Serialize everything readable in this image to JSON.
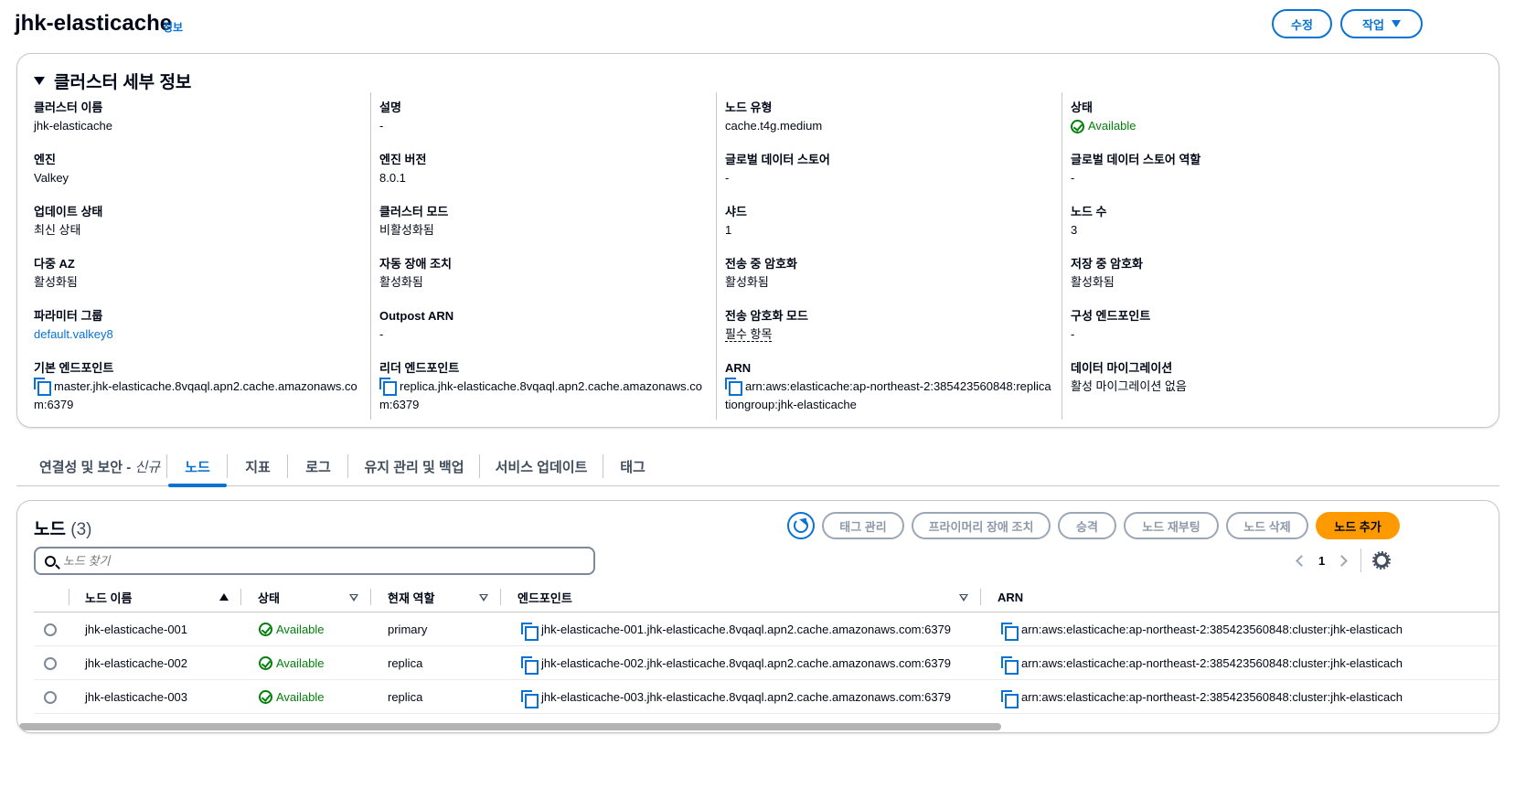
{
  "header": {
    "title": "jhk-elasticache",
    "info_label": "정보",
    "edit_label": "수정",
    "actions_label": "작업"
  },
  "details": {
    "title": "클러스터 세부 정보",
    "columns": [
      [
        {
          "label": "클러스터 이름",
          "value": "jhk-elasticache"
        },
        {
          "label": "엔진",
          "value": "Valkey"
        },
        {
          "label": "업데이트 상태",
          "value": "최신 상태"
        },
        {
          "label": "다중 AZ",
          "value": "활성화됨"
        },
        {
          "label": "파라미터 그룹",
          "value": "default.valkey8"
        },
        {
          "label": "기본 엔드포인트",
          "value": "master.jhk-elasticache.8vqaql.apn2.cache.amazonaws.com:6379"
        }
      ],
      [
        {
          "label": "설명",
          "value": "-"
        },
        {
          "label": "엔진 버전",
          "value": "8.0.1"
        },
        {
          "label": "클러스터 모드",
          "value": "비활성화됨"
        },
        {
          "label": "자동 장애 조치",
          "value": "활성화됨"
        },
        {
          "label": "Outpost ARN",
          "value": "-"
        },
        {
          "label": "리더 엔드포인트",
          "value": "replica.jhk-elasticache.8vqaql.apn2.cache.amazonaws.com:6379"
        }
      ],
      [
        {
          "label": "노드 유형",
          "value": "cache.t4g.medium"
        },
        {
          "label": "글로벌 데이터 스토어",
          "value": "-"
        },
        {
          "label": "샤드",
          "value": "1"
        },
        {
          "label": "전송 중 암호화",
          "value": "활성화됨"
        },
        {
          "label": "전송 암호화 모드",
          "value": "필수 항목"
        },
        {
          "label": "ARN",
          "value": "arn:aws:elasticache:ap-northeast-2:385423560848:replicationgroup:jhk-elasticache"
        }
      ],
      [
        {
          "label": "상태",
          "value": "Available"
        },
        {
          "label": "글로벌 데이터 스토어 역할",
          "value": "-"
        },
        {
          "label": "노드 수",
          "value": "3"
        },
        {
          "label": "저장 중 암호화",
          "value": "활성화됨"
        },
        {
          "label": "구성 엔드포인트",
          "value": "-"
        },
        {
          "label": "데이터 마이그레이션",
          "value": "활성 마이그레이션 없음"
        }
      ]
    ]
  },
  "tabs": [
    {
      "label": "연결성 및 보안 - ",
      "badge": "신규"
    },
    {
      "label": "노드"
    },
    {
      "label": "지표"
    },
    {
      "label": "로그"
    },
    {
      "label": "유지 관리 및 백업"
    },
    {
      "label": "서비스 업데이트"
    },
    {
      "label": "태그"
    }
  ],
  "nodes": {
    "title": "노드",
    "count": "(3)",
    "buttons": {
      "manage_tags": "태그 관리",
      "failover": "프라이머리 장애 조치",
      "promote": "승격",
      "reboot": "노드 재부팅",
      "delete": "노드 삭제",
      "add": "노드 추가"
    },
    "search_placeholder": "노드 찾기",
    "page": "1",
    "columns": {
      "name": "노드 이름",
      "status": "상태",
      "role": "현재 역할",
      "endpoint": "엔드포인트",
      "arn": "ARN"
    },
    "rows": [
      {
        "name": "jhk-elasticache-001",
        "status": "Available",
        "role": "primary",
        "endpoint": "jhk-elasticache-001.jhk-elasticache.8vqaql.apn2.cache.amazonaws.com:6379",
        "arn": "arn:aws:elasticache:ap-northeast-2:385423560848:cluster:jhk-elasticach"
      },
      {
        "name": "jhk-elasticache-002",
        "status": "Available",
        "role": "replica",
        "endpoint": "jhk-elasticache-002.jhk-elasticache.8vqaql.apn2.cache.amazonaws.com:6379",
        "arn": "arn:aws:elasticache:ap-northeast-2:385423560848:cluster:jhk-elasticach"
      },
      {
        "name": "jhk-elasticache-003",
        "status": "Available",
        "role": "replica",
        "endpoint": "jhk-elasticache-003.jhk-elasticache.8vqaql.apn2.cache.amazonaws.com:6379",
        "arn": "arn:aws:elasticache:ap-northeast-2:385423560848:cluster:jhk-elasticach"
      }
    ]
  },
  "colors": {
    "link": "#0972d3",
    "success": "#037f0c",
    "primary_button": "#ff9900",
    "border": "#c6c6cd"
  }
}
